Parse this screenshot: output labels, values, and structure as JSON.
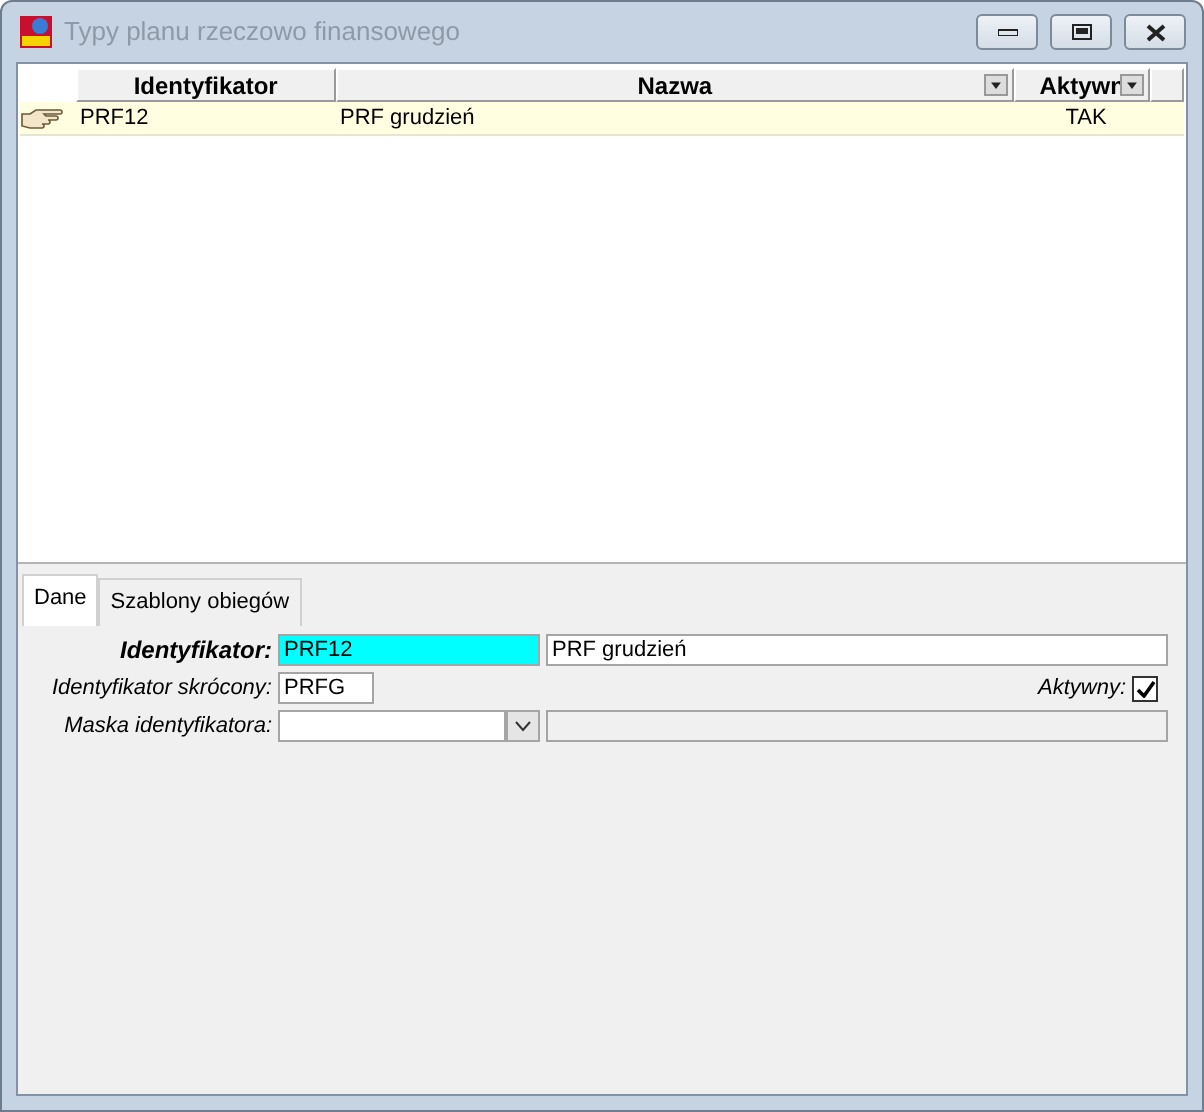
{
  "window": {
    "title": "Typy planu rzeczowo finansowego"
  },
  "grid": {
    "columns": [
      {
        "label": "Identyfikator",
        "dropdown": false
      },
      {
        "label": "Nazwa",
        "dropdown": true
      },
      {
        "label": "Aktywn",
        "dropdown": true
      }
    ],
    "rows": [
      {
        "cells": [
          "PRF12",
          "PRF grudzień",
          "TAK"
        ],
        "selected": true
      }
    ]
  },
  "tabs": [
    {
      "label": "Dane",
      "selected": true
    },
    {
      "label": "Szablony obiegów",
      "selected": false
    }
  ],
  "form": {
    "identyfikator": {
      "label": "Identyfikator:",
      "value": "PRF12",
      "name_value": "PRF grudzień"
    },
    "skrocony": {
      "label": "Identyfikator skrócony:",
      "value": "PRFG"
    },
    "aktywny": {
      "label": "Aktywny:",
      "checked": true
    },
    "maska": {
      "label": "Maska identyfikatora:"
    }
  }
}
